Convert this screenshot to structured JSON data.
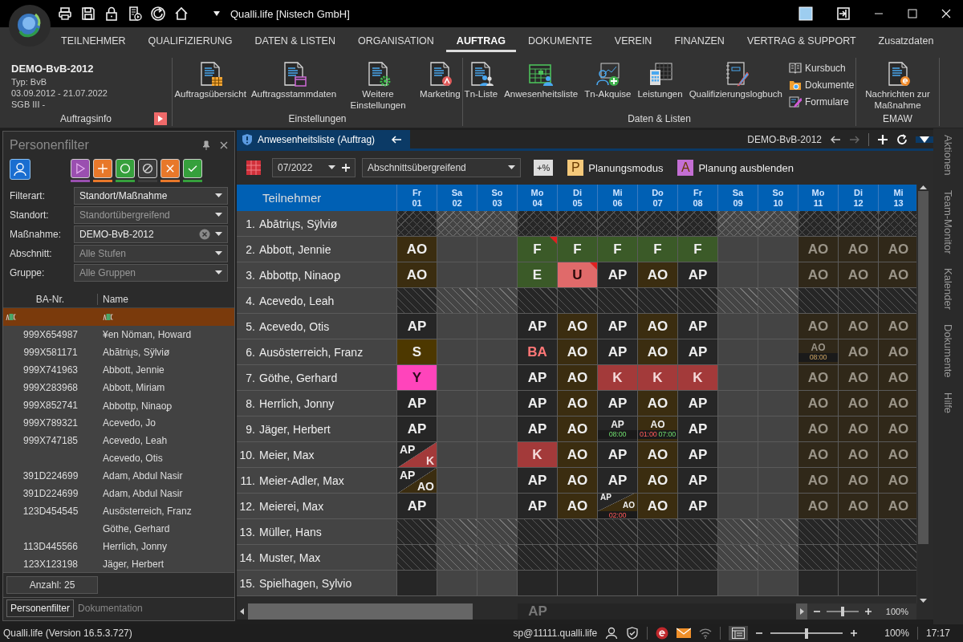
{
  "window": {
    "title": "Qualli.life [Nistech GmbH]"
  },
  "menu": [
    {
      "label": "TEILNEHMER",
      "selected": false
    },
    {
      "label": "QUALIFIZIERUNG",
      "selected": false
    },
    {
      "label": "DATEN & LISTEN",
      "selected": false
    },
    {
      "label": "ORGANISATION",
      "selected": false
    },
    {
      "label": "AUFTRAG",
      "selected": true
    },
    {
      "label": "DOKUMENTE",
      "selected": false
    },
    {
      "label": "VEREIN",
      "selected": false
    },
    {
      "label": "FINANZEN",
      "selected": false
    },
    {
      "label": "VERTRAG & SUPPORT",
      "selected": false
    },
    {
      "label": "Zusatzdaten",
      "selected": false
    }
  ],
  "ribbon": {
    "info": {
      "title": "DEMO-BvB-2012",
      "lines": [
        "Typ: BvB",
        "03.09.2012 - 21.07.2022",
        "SGB III -"
      ],
      "group": "Auftragsinfo"
    },
    "groups": [
      {
        "label": "Einstellungen",
        "buttons": [
          "Auftragsübersicht",
          "Auftragsstammdaten",
          "Weitere Einstellungen",
          "Marketing"
        ]
      },
      {
        "label": "Daten & Listen",
        "buttons": [
          "Tn-Liste",
          "Anwesenheitsliste",
          "Tn-Akquise",
          "Leistungen",
          "Qualifizierungslogbuch"
        ],
        "small_buttons": [
          "Kursbuch",
          "Dokumente",
          "Formulare"
        ]
      },
      {
        "label": "EMAW",
        "buttons": [
          "Nachrichten zur Maßnahme"
        ]
      }
    ]
  },
  "filter_panel": {
    "title": "Personenfilter",
    "status_buttons": [
      {
        "kind": "play",
        "color": "#9a4fb0"
      },
      {
        "kind": "plus",
        "color": "#e8782a"
      },
      {
        "kind": "circle",
        "color": "#36a03c"
      },
      {
        "kind": "none",
        "color": "#3c3c3c"
      },
      {
        "kind": "cross",
        "color": "#e8782a"
      },
      {
        "kind": "check",
        "color": "#36a03c"
      }
    ],
    "filters": [
      {
        "label": "Filterart:",
        "value": "Standort/Maßnahme",
        "clearable": false
      },
      {
        "label": "Standort:",
        "placeholder": "Standortübergreifend",
        "clearable": false
      },
      {
        "label": "Maßnahme:",
        "value": "DEMO-BvB-2012",
        "clearable": true
      },
      {
        "label": "Abschnitt:",
        "placeholder": "Alle Stufen",
        "clearable": false
      },
      {
        "label": "Gruppe:",
        "placeholder": "Alle Gruppen",
        "clearable": false
      }
    ],
    "columns": [
      "BA-Nr.",
      "Name"
    ],
    "rows": [
      {
        "ba": "999X654987",
        "name": "¥en Nöman, Howard"
      },
      {
        "ba": "999X581171",
        "name": "Abā̄triųs, Sÿlviø"
      },
      {
        "ba": "999X741963",
        "name": "Abbott, Jennie"
      },
      {
        "ba": "999X283968",
        "name": "Abbott, Miriam"
      },
      {
        "ba": "999X852741",
        "name": "Abbottp, Ninaoꝑ"
      },
      {
        "ba": "999X789321",
        "name": "Acevedo, Jo"
      },
      {
        "ba": "999X747185",
        "name": "Acevedo, Leah"
      },
      {
        "name": "Acevedo, Otis"
      },
      {
        "ba": "391D224699",
        "name": "Adam, Abdul Nasir"
      },
      {
        "ba": "391D224699",
        "name": "Adam, Abdul Nasir"
      },
      {
        "ba": "123D454545",
        "name": "Ausösterreich, Franz"
      },
      {
        "name": "Göthe, Gerhard"
      },
      {
        "ba": "113D445566",
        "name": "Herrlich, Jonny"
      },
      {
        "ba": "123X123198",
        "name": "Jäger, Herbert"
      }
    ],
    "count": "Anzahl: 25",
    "tabs": [
      {
        "label": "Personenfilter",
        "selected": true
      },
      {
        "label": "Dokumentation",
        "selected": false
      }
    ]
  },
  "attendance": {
    "tab": "Anwesenheitsliste (Auftrag)",
    "context": "DEMO-BvB-2012",
    "month": "07/2022",
    "section": "Abschnittsübergreifend",
    "percent_button": "+%",
    "toggles": [
      {
        "badge": "P",
        "label": "Planungsmodus",
        "color": "#f5c97a"
      },
      {
        "badge": "A",
        "label": "Planung ausblenden",
        "color": "#c46fd4"
      }
    ],
    "name_header": "Teilnehmer",
    "days": [
      {
        "dow": "Fr",
        "day": "01",
        "weekend": false
      },
      {
        "dow": "Sa",
        "day": "02",
        "weekend": true
      },
      {
        "dow": "So",
        "day": "03",
        "weekend": true
      },
      {
        "dow": "Mo",
        "day": "04",
        "weekend": false
      },
      {
        "dow": "Di",
        "day": "05",
        "weekend": false
      },
      {
        "dow": "Mi",
        "day": "06",
        "weekend": false
      },
      {
        "dow": "Do",
        "day": "07",
        "weekend": false
      },
      {
        "dow": "Fr",
        "day": "08",
        "weekend": false
      },
      {
        "dow": "Sa",
        "day": "09",
        "weekend": true
      },
      {
        "dow": "So",
        "day": "10",
        "weekend": true
      },
      {
        "dow": "Mo",
        "day": "11",
        "weekend": false
      },
      {
        "dow": "Di",
        "day": "12",
        "weekend": false
      },
      {
        "dow": "Mi",
        "day": "13",
        "weekend": false
      }
    ],
    "rows": [
      {
        "number": "1.",
        "name": "Abātriųs, Sÿlviø",
        "cells": [
          {
            "kind": "cross"
          },
          {
            "kind": "cross"
          },
          {
            "kind": "cross"
          },
          {
            "kind": "cross"
          },
          {
            "kind": "cross"
          },
          {
            "kind": "cross"
          },
          {
            "kind": "cross"
          },
          {
            "kind": "cross"
          },
          {
            "kind": "cross"
          },
          {
            "kind": "cross"
          },
          {
            "kind": "cross"
          },
          {
            "kind": "cross"
          },
          {
            "kind": "cross"
          }
        ]
      },
      {
        "number": "2.",
        "name": "Abbott, Jennie",
        "cells": [
          {
            "kind": "ao",
            "code": "AO",
            "planned": false,
            "flag": false
          },
          {
            "kind": "blank"
          },
          {
            "kind": "blank"
          },
          {
            "kind": "f",
            "code": "F",
            "planned": false,
            "flag": true
          },
          {
            "kind": "f",
            "code": "F",
            "planned": false,
            "flag": false
          },
          {
            "kind": "f",
            "code": "F",
            "planned": false,
            "flag": false
          },
          {
            "kind": "f",
            "code": "F",
            "planned": false,
            "flag": false
          },
          {
            "kind": "f",
            "code": "F",
            "planned": false,
            "flag": false
          },
          {
            "kind": "blank"
          },
          {
            "kind": "blank"
          },
          {
            "kind": "ao",
            "code": "AO",
            "planned": true,
            "flag": false
          },
          {
            "kind": "ao",
            "code": "AO",
            "planned": true,
            "flag": false
          },
          {
            "kind": "ao",
            "code": "AO",
            "planned": true,
            "flag": false
          }
        ]
      },
      {
        "number": "3.",
        "name": "Abbottp, Ninaoꝑ",
        "cells": [
          {
            "kind": "ao",
            "code": "AO",
            "planned": false,
            "flag": false
          },
          {
            "kind": "blank"
          },
          {
            "kind": "blank"
          },
          {
            "kind": "f",
            "code": "E",
            "planned": false,
            "flag": false
          },
          {
            "kind": "u",
            "code": "U",
            "planned": false,
            "flag": true
          },
          {
            "kind": "ap",
            "code": "AP",
            "planned": false,
            "flag": false
          },
          {
            "kind": "ao",
            "code": "AO",
            "planned": false,
            "flag": false
          },
          {
            "kind": "ap",
            "code": "AP",
            "planned": false,
            "flag": false
          },
          {
            "kind": "blank"
          },
          {
            "kind": "blank"
          },
          {
            "kind": "ao",
            "code": "AO",
            "planned": true,
            "flag": false
          },
          {
            "kind": "ao",
            "code": "AO",
            "planned": true,
            "flag": false
          },
          {
            "kind": "ao",
            "code": "AO",
            "planned": true,
            "flag": false
          }
        ]
      },
      {
        "number": "4.",
        "name": "Acevedo, Leah",
        "cells": [
          {
            "kind": "hatch"
          },
          {
            "kind": "hatch"
          },
          {
            "kind": "hatch"
          },
          {
            "kind": "hatch"
          },
          {
            "kind": "hatch"
          },
          {
            "kind": "hatch"
          },
          {
            "kind": "hatch"
          },
          {
            "kind": "hatch"
          },
          {
            "kind": "hatch"
          },
          {
            "kind": "hatch"
          },
          {
            "kind": "hatch"
          },
          {
            "kind": "hatch"
          },
          {
            "kind": "hatch"
          }
        ]
      },
      {
        "number": "5.",
        "name": "Acevedo, Otis",
        "cells": [
          {
            "kind": "ap",
            "code": "AP",
            "planned": false,
            "flag": false
          },
          {
            "kind": "blank"
          },
          {
            "kind": "blank"
          },
          {
            "kind": "ap",
            "code": "AP",
            "planned": false,
            "flag": false
          },
          {
            "kind": "ao",
            "code": "AO",
            "planned": false,
            "flag": false
          },
          {
            "kind": "ap",
            "code": "AP",
            "planned": false,
            "flag": false
          },
          {
            "kind": "ao",
            "code": "AO",
            "planned": false,
            "flag": false
          },
          {
            "kind": "ap",
            "code": "AP",
            "planned": false,
            "flag": false
          },
          {
            "kind": "blank"
          },
          {
            "kind": "blank"
          },
          {
            "kind": "ao",
            "code": "AO",
            "planned": true,
            "flag": false
          },
          {
            "kind": "ao",
            "code": "AO",
            "planned": true,
            "flag": false
          },
          {
            "kind": "ao",
            "code": "AO",
            "planned": true,
            "flag": false
          }
        ]
      },
      {
        "number": "6.",
        "name": "Ausösterreich, Franz",
        "cells": [
          {
            "kind": "s",
            "code": "S",
            "planned": false,
            "flag": false
          },
          {
            "kind": "blank"
          },
          {
            "kind": "blank"
          },
          {
            "kind": "ba",
            "code": "BA",
            "planned": false,
            "flag": false
          },
          {
            "kind": "ao",
            "code": "AO",
            "planned": false,
            "flag": false
          },
          {
            "kind": "ap",
            "code": "AP",
            "planned": false,
            "flag": false
          },
          {
            "kind": "ao",
            "code": "AO",
            "planned": false,
            "flag": false
          },
          {
            "kind": "ap",
            "code": "AP",
            "planned": false,
            "flag": false
          },
          {
            "kind": "blank"
          },
          {
            "kind": "blank"
          },
          {
            "kind": "ao",
            "code": "AO",
            "planned": true,
            "flag": false,
            "times": [
              {
                "text": "08:00",
                "kind": "planned"
              }
            ]
          },
          {
            "kind": "ao",
            "code": "AO",
            "planned": true,
            "flag": false
          },
          {
            "kind": "ao",
            "code": "AO",
            "planned": true,
            "flag": false
          }
        ]
      },
      {
        "number": "7.",
        "name": "Göthe, Gerhard",
        "cells": [
          {
            "kind": "y",
            "code": "Y",
            "planned": false,
            "flag": false
          },
          {
            "kind": "blank"
          },
          {
            "kind": "blank"
          },
          {
            "kind": "ap",
            "code": "AP",
            "planned": false,
            "flag": false
          },
          {
            "kind": "ao",
            "code": "AO",
            "planned": false,
            "flag": false
          },
          {
            "kind": "k",
            "code": "K",
            "planned": false,
            "flag": false
          },
          {
            "kind": "k",
            "code": "K",
            "planned": false,
            "flag": false
          },
          {
            "kind": "k",
            "code": "K",
            "planned": false,
            "flag": false
          },
          {
            "kind": "blank"
          },
          {
            "kind": "blank"
          },
          {
            "kind": "ao",
            "code": "AO",
            "planned": true,
            "flag": false
          },
          {
            "kind": "ao",
            "code": "AO",
            "planned": true,
            "flag": false
          },
          {
            "kind": "ao",
            "code": "AO",
            "planned": true,
            "flag": false
          }
        ]
      },
      {
        "number": "8.",
        "name": "Herrlich, Jonny",
        "cells": [
          {
            "kind": "ap",
            "code": "AP",
            "planned": false,
            "flag": false
          },
          {
            "kind": "blank"
          },
          {
            "kind": "blank"
          },
          {
            "kind": "ap",
            "code": "AP",
            "planned": false,
            "flag": false
          },
          {
            "kind": "ao",
            "code": "AO",
            "planned": false,
            "flag": false
          },
          {
            "kind": "ap",
            "code": "AP",
            "planned": false,
            "flag": false
          },
          {
            "kind": "ao",
            "code": "AO",
            "planned": false,
            "flag": false
          },
          {
            "kind": "ap",
            "code": "AP",
            "planned": false,
            "flag": false
          },
          {
            "kind": "blank"
          },
          {
            "kind": "blank"
          },
          {
            "kind": "ao",
            "code": "AO",
            "planned": true,
            "flag": false
          },
          {
            "kind": "ao",
            "code": "AO",
            "planned": true,
            "flag": false
          },
          {
            "kind": "ao",
            "code": "AO",
            "planned": true,
            "flag": false
          }
        ]
      },
      {
        "number": "9.",
        "name": "Jäger, Herbert",
        "cells": [
          {
            "kind": "ap",
            "code": "AP",
            "planned": false,
            "flag": false
          },
          {
            "kind": "blank"
          },
          {
            "kind": "blank"
          },
          {
            "kind": "ap",
            "code": "AP",
            "planned": false,
            "flag": false
          },
          {
            "kind": "ao",
            "code": "AO",
            "planned": false,
            "flag": false
          },
          {
            "kind": "ap",
            "code": "AP",
            "planned": false,
            "flag": false,
            "times": [
              {
                "text": "08:00",
                "kind": "actual"
              }
            ]
          },
          {
            "kind": "ao",
            "code": "AO",
            "planned": false,
            "flag": false,
            "times": [
              {
                "text": "01:00",
                "kind": "missing"
              },
              {
                "text": "07:00",
                "kind": "actual"
              }
            ]
          },
          {
            "kind": "ap",
            "code": "AP",
            "planned": false,
            "flag": false
          },
          {
            "kind": "blank"
          },
          {
            "kind": "blank"
          },
          {
            "kind": "ao",
            "code": "AO",
            "planned": true,
            "flag": false
          },
          {
            "kind": "ao",
            "code": "AO",
            "planned": true,
            "flag": false
          },
          {
            "kind": "ao",
            "code": "AO",
            "planned": true,
            "flag": false
          }
        ]
      },
      {
        "number": "10.",
        "name": "Meier, Max",
        "cells": [
          {
            "kind": "split",
            "parts": [
              {
                "code": "AP",
                "kind": "ap"
              },
              {
                "code": "K",
                "kind": "k"
              }
            ]
          },
          {
            "kind": "blank"
          },
          {
            "kind": "blank"
          },
          {
            "kind": "k",
            "code": "K",
            "planned": false,
            "flag": false
          },
          {
            "kind": "ao",
            "code": "AO",
            "planned": false,
            "flag": false
          },
          {
            "kind": "ap",
            "code": "AP",
            "planned": false,
            "flag": false
          },
          {
            "kind": "ao",
            "code": "AO",
            "planned": false,
            "flag": false
          },
          {
            "kind": "ap",
            "code": "AP",
            "planned": false,
            "flag": false
          },
          {
            "kind": "blank"
          },
          {
            "kind": "blank"
          },
          {
            "kind": "ao",
            "code": "AO",
            "planned": true,
            "flag": false
          },
          {
            "kind": "ao",
            "code": "AO",
            "planned": true,
            "flag": false
          },
          {
            "kind": "ao",
            "code": "AO",
            "planned": true,
            "flag": false
          }
        ]
      },
      {
        "number": "11.",
        "name": "Meier-Adler, Max",
        "cells": [
          {
            "kind": "split",
            "parts": [
              {
                "code": "AP",
                "kind": "ap"
              },
              {
                "code": "AO",
                "kind": "ao"
              }
            ]
          },
          {
            "kind": "blank"
          },
          {
            "kind": "blank"
          },
          {
            "kind": "ap",
            "code": "AP",
            "planned": false,
            "flag": false
          },
          {
            "kind": "ao",
            "code": "AO",
            "planned": false,
            "flag": false
          },
          {
            "kind": "ap",
            "code": "AP",
            "planned": false,
            "flag": false
          },
          {
            "kind": "ao",
            "code": "AO",
            "planned": false,
            "flag": false
          },
          {
            "kind": "ap",
            "code": "AP",
            "planned": false,
            "flag": false
          },
          {
            "kind": "blank"
          },
          {
            "kind": "blank"
          },
          {
            "kind": "ao",
            "code": "AO",
            "planned": true,
            "flag": false
          },
          {
            "kind": "ao",
            "code": "AO",
            "planned": true,
            "flag": false
          },
          {
            "kind": "ao",
            "code": "AO",
            "planned": true,
            "flag": false
          }
        ]
      },
      {
        "number": "12.",
        "name": "Meierei, Max",
        "cells": [
          {
            "kind": "ap",
            "code": "AP",
            "planned": false,
            "flag": false
          },
          {
            "kind": "blank"
          },
          {
            "kind": "blank"
          },
          {
            "kind": "ap",
            "code": "AP",
            "planned": false,
            "flag": false
          },
          {
            "kind": "ao",
            "code": "AO",
            "planned": false,
            "flag": false
          },
          {
            "kind": "split",
            "parts": [
              {
                "code": "AP",
                "kind": "ap"
              },
              {
                "code": "AO",
                "kind": "ao"
              }
            ],
            "times": [
              {
                "text": "02:00",
                "kind": "missing"
              }
            ]
          },
          {
            "kind": "ao",
            "code": "AO",
            "planned": false,
            "flag": false
          },
          {
            "kind": "ap",
            "code": "AP",
            "planned": false,
            "flag": false
          },
          {
            "kind": "blank"
          },
          {
            "kind": "blank"
          },
          {
            "kind": "ao",
            "code": "AO",
            "planned": true,
            "flag": false
          },
          {
            "kind": "ao",
            "code": "AO",
            "planned": true,
            "flag": false
          },
          {
            "kind": "ao",
            "code": "AO",
            "planned": true,
            "flag": false
          }
        ]
      },
      {
        "number": "13.",
        "name": "Müller, Hans",
        "cells": [
          {
            "kind": "hatch"
          },
          {
            "kind": "hatch"
          },
          {
            "kind": "hatch"
          },
          {
            "kind": "hatch"
          },
          {
            "kind": "hatch"
          },
          {
            "kind": "hatch"
          },
          {
            "kind": "hatch"
          },
          {
            "kind": "hatch"
          },
          {
            "kind": "hatch"
          },
          {
            "kind": "hatch"
          },
          {
            "kind": "hatch"
          },
          {
            "kind": "hatch"
          },
          {
            "kind": "hatch"
          }
        ]
      },
      {
        "number": "14.",
        "name": "Muster, Max",
        "cells": [
          {
            "kind": "hatch"
          },
          {
            "kind": "hatch"
          },
          {
            "kind": "hatch"
          },
          {
            "kind": "hatch"
          },
          {
            "kind": "hatch"
          },
          {
            "kind": "hatch"
          },
          {
            "kind": "hatch"
          },
          {
            "kind": "hatch"
          },
          {
            "kind": "hatch"
          },
          {
            "kind": "hatch"
          },
          {
            "kind": "hatch"
          },
          {
            "kind": "hatch"
          },
          {
            "kind": "hatch"
          }
        ]
      },
      {
        "number": "15.",
        "name": "Spielhagen, Sylvio",
        "cells": [
          {
            "kind": "blank"
          },
          {
            "kind": "blank"
          },
          {
            "kind": "blank"
          },
          {
            "kind": "blank"
          },
          {
            "kind": "blank"
          },
          {
            "kind": "blank"
          },
          {
            "kind": "blank"
          },
          {
            "kind": "blank"
          },
          {
            "kind": "blank"
          },
          {
            "kind": "blank"
          },
          {
            "kind": "blank"
          },
          {
            "kind": "blank"
          },
          {
            "kind": "blank"
          }
        ]
      }
    ],
    "summary": "AP",
    "zoom": {
      "level": 0.5,
      "reading": "100%"
    }
  },
  "side_panel": [
    "Aktionen",
    "Team-Monitor",
    "Kalender",
    "Dokumente",
    "Hilfe"
  ],
  "status_bar": {
    "version": "Qualli.life (Version 16.5.3.727)",
    "user": "sp@11111.qualli.life",
    "zoom": {
      "level": 0.5,
      "reading": "100%"
    },
    "time": "17:17"
  }
}
